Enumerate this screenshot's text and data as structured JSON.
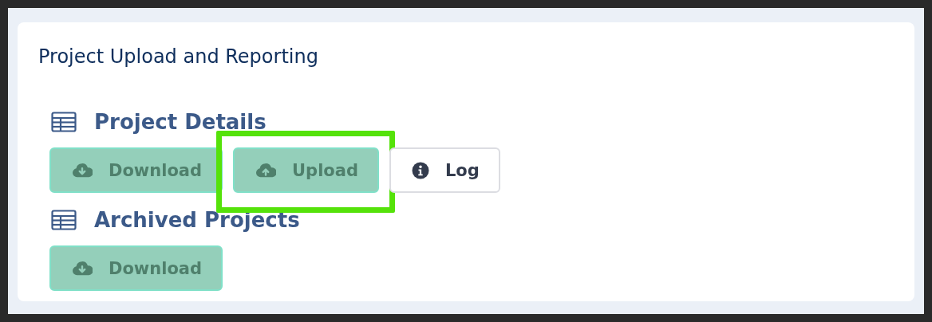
{
  "card": {
    "title": "Project Upload and Reporting"
  },
  "sections": [
    {
      "heading": "Project Details",
      "buttons": [
        {
          "label": "Download",
          "kind": "download",
          "highlighted": false
        },
        {
          "label": "Upload",
          "kind": "upload",
          "highlighted": true
        },
        {
          "label": "Log",
          "kind": "info",
          "highlighted": false
        }
      ]
    },
    {
      "heading": "Archived Projects",
      "buttons": [
        {
          "label": "Download",
          "kind": "download",
          "highlighted": false
        }
      ]
    }
  ]
}
